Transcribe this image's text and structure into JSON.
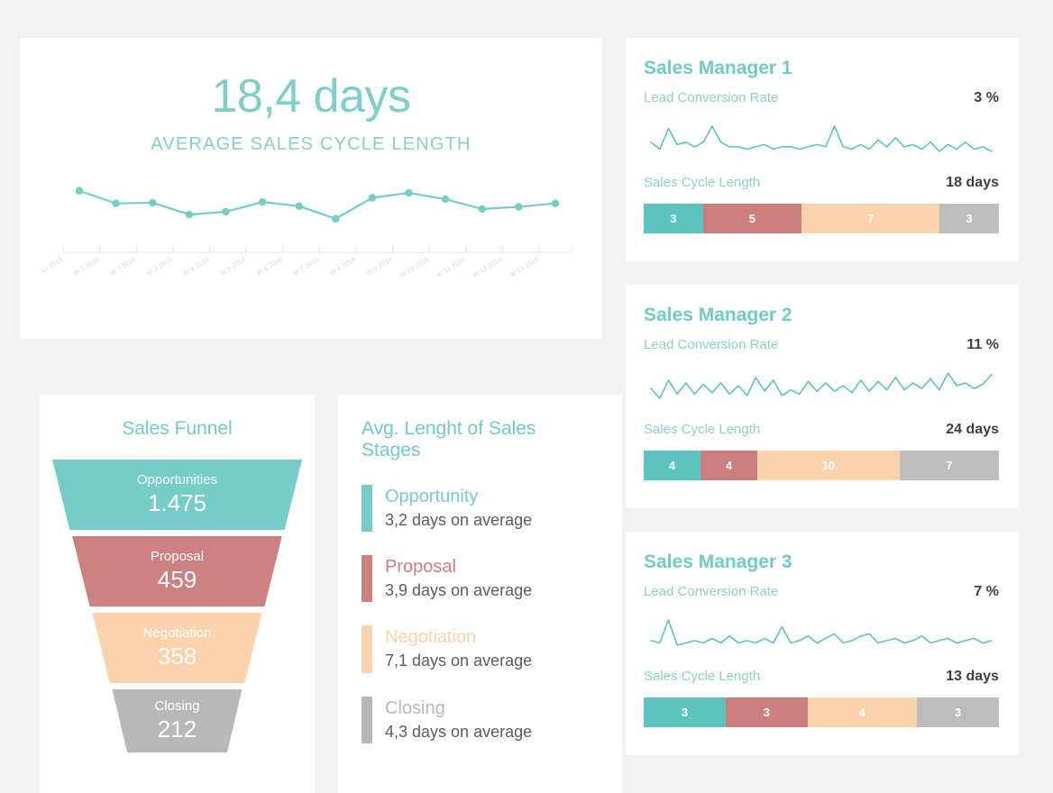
{
  "kpi": {
    "value": "18,4 days",
    "label": "AVERAGE SALES CYCLE LENGTH"
  },
  "funnel": {
    "title": "Sales Funnel",
    "stages": [
      {
        "name": "Opportunities",
        "value": "1.475",
        "color": "#76ccc7"
      },
      {
        "name": "Proposal",
        "value": "459",
        "color": "#cc8080"
      },
      {
        "name": "Negotiation",
        "value": "358",
        "color": "#fbd2ac"
      },
      {
        "name": "Closing",
        "value": "212",
        "color": "#b8b8b8"
      }
    ]
  },
  "stages_card": {
    "title": "Avg. Lenght of Sales Stages",
    "items": [
      {
        "name": "Opportunity",
        "detail": "3,2 days on average",
        "color": "#76ccc7"
      },
      {
        "name": "Proposal",
        "detail": "3,9 days on average",
        "color": "#cc8080"
      },
      {
        "name": "Negotiation",
        "detail": "7,1 days on average",
        "color": "#fbd2ac"
      },
      {
        "name": "Closing",
        "detail": "4,3 days on average",
        "color": "#b8b8b8"
      }
    ]
  },
  "managers": [
    {
      "title": "Sales Manager 1",
      "conversion_label": "Lead Conversion Rate",
      "conversion_value": "3 %",
      "cycle_label": "Sales Cycle Length",
      "cycle_value": "18 days",
      "segments": [
        {
          "value": "3",
          "color": "#5bc4bf"
        },
        {
          "value": "5",
          "color": "#cc7d7d"
        },
        {
          "value": "7",
          "color": "#fbd2ac"
        },
        {
          "value": "3",
          "color": "#bdbdbd"
        }
      ]
    },
    {
      "title": "Sales Manager 2",
      "conversion_label": "Lead Conversion Rate",
      "conversion_value": "11 %",
      "cycle_label": "Sales Cycle Length",
      "cycle_value": "24 days",
      "segments": [
        {
          "value": "4",
          "color": "#5bc4bf"
        },
        {
          "value": "4",
          "color": "#cc7d7d"
        },
        {
          "value": "10",
          "color": "#fbd2ac"
        },
        {
          "value": "7",
          "color": "#bdbdbd"
        }
      ]
    },
    {
      "title": "Sales Manager 3",
      "conversion_label": "Lead Conversion Rate",
      "conversion_value": "7 %",
      "cycle_label": "Sales Cycle Length",
      "cycle_value": "13 days",
      "segments": [
        {
          "value": "3",
          "color": "#5bc4bf"
        },
        {
          "value": "3",
          "color": "#cc7d7d"
        },
        {
          "value": "4",
          "color": "#fbd2ac"
        },
        {
          "value": "3",
          "color": "#bdbdbd"
        }
      ]
    }
  ],
  "colors": {
    "teal": "#76ccc7",
    "teal_text": "#6ecbc5",
    "rose": "#cc8080",
    "peach": "#fbd2ac",
    "gray": "#b8b8b8",
    "background": "#f2f2f2",
    "card": "#ffffff"
  },
  "chart_data": [
    {
      "type": "line",
      "title": "Average sales cycle length trend",
      "xlabel": "",
      "ylabel": "",
      "grid": false,
      "legend": "none",
      "ylim": [
        14,
        22
      ],
      "categories": [
        "W 53 2015",
        "W 1 2016",
        "W 2 2016",
        "W 3 2016",
        "W 4 2016",
        "W 5 2016",
        "W 6 2016",
        "W 7 2016",
        "W 8 2016",
        "W 9 2016",
        "W 10 2016",
        "W 11 2016",
        "W 12 2016",
        "W 13 2016"
      ],
      "values": [
        21.0,
        19.2,
        19.3,
        17.6,
        18.0,
        19.4,
        18.8,
        17.0,
        20.0,
        20.7,
        19.8,
        18.4,
        18.7,
        19.2
      ]
    },
    {
      "type": "line",
      "title": "Sales Manager 1 lead conversion rate sparkline",
      "values": [
        3.0,
        2.7,
        3.6,
        2.9,
        3.0,
        2.8,
        3.0,
        3.7,
        3.0,
        2.8,
        2.8,
        2.7,
        2.8,
        2.9,
        2.7,
        2.8,
        2.8,
        2.7,
        2.8,
        2.9,
        2.8,
        3.7,
        2.8,
        2.7,
        2.9,
        2.7,
        3.1,
        2.8,
        3.2,
        2.8,
        2.9,
        2.7,
        3.0,
        2.6,
        2.9,
        2.7,
        3.0,
        2.7,
        2.8,
        2.6
      ]
    },
    {
      "type": "line",
      "title": "Sales Manager 2 lead conversion rate sparkline",
      "values": [
        11.0,
        10.3,
        11.6,
        10.6,
        11.4,
        10.6,
        11.3,
        10.7,
        11.4,
        10.6,
        11.2,
        10.5,
        11.8,
        10.8,
        11.6,
        10.5,
        10.9,
        10.6,
        11.5,
        10.8,
        11.4,
        10.8,
        11.2,
        10.7,
        11.6,
        10.8,
        11.5,
        10.9,
        11.8,
        10.9,
        11.4,
        11.0,
        11.7,
        10.9,
        12.1,
        11.2,
        11.4,
        11.0,
        11.3,
        12.0
      ]
    },
    {
      "type": "line",
      "title": "Sales Manager 3 lead conversion rate sparkline",
      "values": [
        7.0,
        6.9,
        7.9,
        6.8,
        6.9,
        7.0,
        6.9,
        7.1,
        6.9,
        7.2,
        6.9,
        7.0,
        6.9,
        7.1,
        6.9,
        7.6,
        6.9,
        7.0,
        7.2,
        6.9,
        7.1,
        7.3,
        6.9,
        7.0,
        7.2,
        7.3,
        6.9,
        7.0,
        7.1,
        6.9,
        7.0,
        7.2,
        6.9,
        7.0,
        7.1,
        6.9,
        7.0,
        7.1,
        6.9,
        7.0
      ]
    }
  ]
}
